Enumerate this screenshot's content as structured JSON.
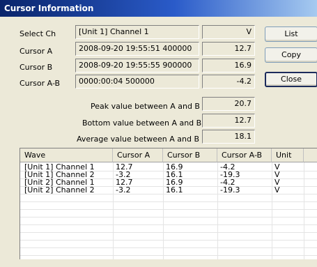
{
  "window": {
    "title": "Cursor Information"
  },
  "fields": {
    "select_ch": {
      "label": "Select Ch",
      "value": "[Unit 1] Channel 1",
      "unit": "V"
    },
    "cursor_a": {
      "label": "Cursor A",
      "value": "2008-09-20 19:55:51 400000",
      "number": "12.7"
    },
    "cursor_b": {
      "label": "Cursor B",
      "value": "2008-09-20 19:55:55 900000",
      "number": "16.9"
    },
    "cursor_ab": {
      "label": "Cursor A-B",
      "value": "0000:00:04 500000",
      "number": "-4.2"
    }
  },
  "stats": {
    "peak": {
      "label": "Peak value between A and B",
      "value": "20.7"
    },
    "bottom": {
      "label": "Bottom value between A and B",
      "value": "12.7"
    },
    "average": {
      "label": "Average value between A and B",
      "value": "18.1"
    }
  },
  "buttons": {
    "list": "List",
    "copy": "Copy",
    "close": "Close"
  },
  "table": {
    "headers": [
      "Wave",
      "Cursor A",
      "Cursor B",
      "Cursor A-B",
      "Unit"
    ],
    "rows": [
      [
        "[Unit 1] Channel 1",
        "12.7",
        "16.9",
        "-4.2",
        "V"
      ],
      [
        "[Unit 1] Channel 2",
        "-3.2",
        "16.1",
        "-19.3",
        "V"
      ],
      [
        "[Unit 2] Channel 1",
        "12.7",
        "16.9",
        "-4.2",
        "V"
      ],
      [
        "[Unit 2] Channel 2",
        "-3.2",
        "16.1",
        "-19.3",
        "V"
      ]
    ]
  }
}
